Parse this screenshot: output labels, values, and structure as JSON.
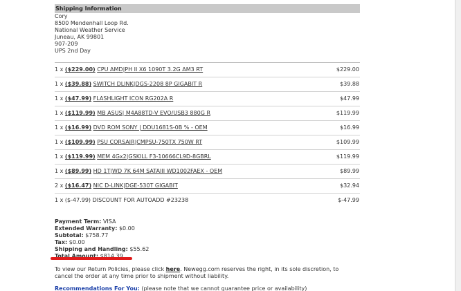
{
  "shipping": {
    "header": "Shipping Information",
    "name": "Cory",
    "address1": "8500 Mendenhall Loop Rd.",
    "address2": "National Weather Service",
    "city_line": "Juneau, AK 99801",
    "phone": "907-209",
    "method": "UPS 2nd Day"
  },
  "orders": [
    {
      "qty": "1 x",
      "price": "($229.00)",
      "item": "CPU AMD|PH II X6 1090T 3.2G AM3 RT",
      "amount": "$229.00"
    },
    {
      "qty": "1 x",
      "price": "($39.88)",
      "item": "SWITCH DLINK|DGS-2208 8P GIGABIT R",
      "amount": "$39.88"
    },
    {
      "qty": "1 x",
      "price": "($47.99)",
      "item": "FLASHLIGHT ICON RG202A R",
      "amount": "$47.99"
    },
    {
      "qty": "1 x",
      "price": "($119.99)",
      "item": "MB ASUS| M4A88TD-V EVO/USB3 880G R",
      "amount": "$119.99"
    },
    {
      "qty": "1 x",
      "price": "($16.99)",
      "item": "DVD ROM SONY | DDU1681S-0B % - OEM",
      "amount": "$16.99"
    },
    {
      "qty": "1 x",
      "price": "($109.99)",
      "item": "PSU CORSAIR|CMPSU-750TX 750W RT",
      "amount": "$109.99"
    },
    {
      "qty": "1 x",
      "price": "($119.99)",
      "item": "MEM 4Gx2|GSKILL F3-10666CL9D-8GBRL",
      "amount": "$119.99"
    },
    {
      "qty": "1 x",
      "price": "($89.99)",
      "item": "HD 1T|WD 7K 64M SATAIII WD1002FAEX - OEM",
      "amount": "$89.99"
    },
    {
      "qty": "2 x",
      "price": "($16.47)",
      "item": "NIC D-LINK|DGE-530T GIGABIT",
      "amount": "$32.94"
    },
    {
      "qty": "1 x",
      "price": "($-47.99)",
      "item": "DISCOUNT FOR AUTOADD #23238",
      "amount": "$-47.99"
    }
  ],
  "summary": {
    "payment_term_label": "Payment Term:",
    "payment_term_value": "VISA",
    "ext_warranty_label": "Extended Warranty:",
    "ext_warranty_value": "$0.00",
    "subtotal_label": "Subtotal:",
    "subtotal_value": "$758.77",
    "tax_label": "Tax:",
    "tax_value": "$0.00",
    "shipping_label": "Shipping and Handling:",
    "shipping_value": "$55.62",
    "total_label": "Total Amount:",
    "total_value": "$814.39"
  },
  "policy": {
    "line1_pre": "To view our Return Policies, please click",
    "link": "here",
    "line1_post": ". Newegg.com reserves the right, in its sole discretion, to",
    "line2": "cancel the order at any time prior to shipment without liability."
  },
  "reco": {
    "link": "Recommendations For You:",
    "note": "(please note that we cannot guarantee price or availability)"
  },
  "colors": {
    "header_bg": "#c9c9c9",
    "highlight": "#e01b1b",
    "link_blue": "#1a3fa8"
  }
}
